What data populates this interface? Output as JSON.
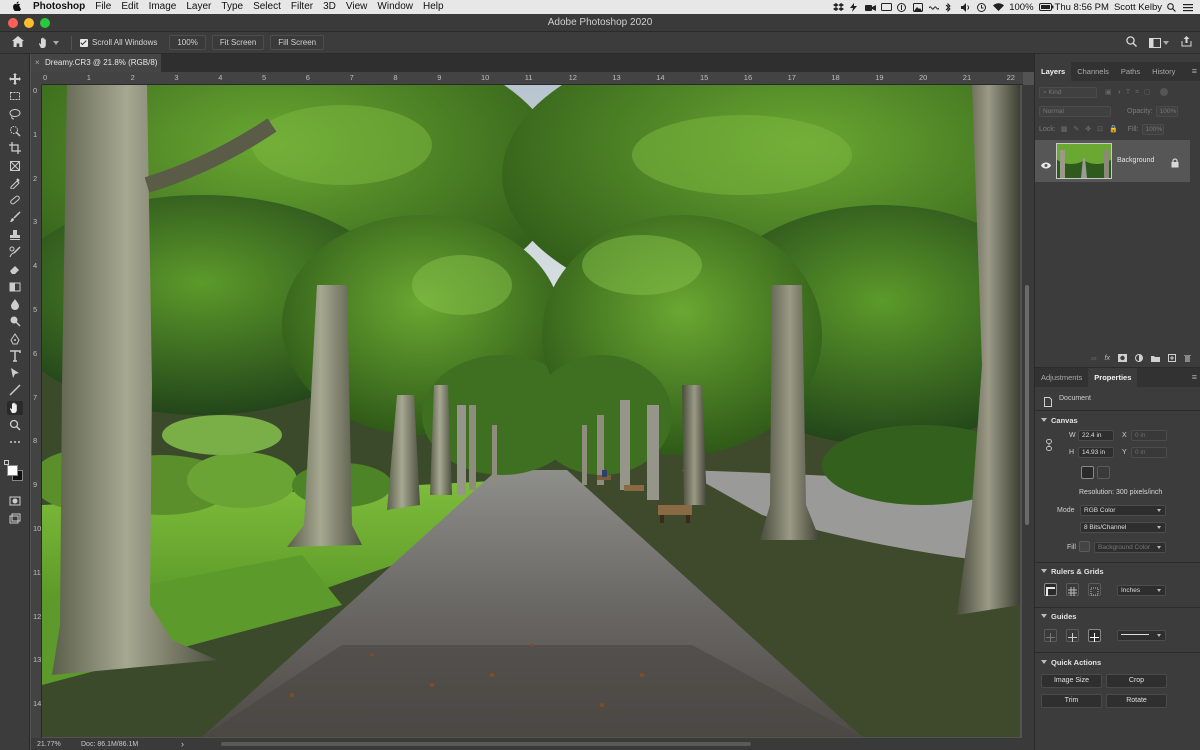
{
  "menubar": {
    "app_name": "Photoshop",
    "items": [
      "File",
      "Edit",
      "Image",
      "Layer",
      "Type",
      "Select",
      "Filter",
      "3D",
      "View",
      "Window",
      "Help"
    ],
    "battery": "100%",
    "clock": "Thu 8:56 PM",
    "user": "Scott Kelby"
  },
  "window": {
    "title": "Adobe Photoshop 2020",
    "traffic_colors": [
      "#ff5f56",
      "#ffbd2e",
      "#27c93f"
    ]
  },
  "options_bar": {
    "scroll_all_windows": "Scroll All Windows",
    "zoom_100": "100%",
    "fit_screen": "Fit Screen",
    "fill_screen": "Fill Screen"
  },
  "document": {
    "tab_title": "Dreamy.CR3 @ 21.8% (RGB/8)",
    "close_glyph": "×"
  },
  "rulers": {
    "top_labels": [
      "0",
      "1",
      "2",
      "3",
      "4",
      "5",
      "6",
      "7",
      "8",
      "9",
      "10",
      "11",
      "12",
      "13",
      "14",
      "15",
      "16",
      "17",
      "18",
      "19",
      "20",
      "21",
      "22"
    ],
    "left_labels": [
      "0",
      "1",
      "2",
      "3",
      "4",
      "5",
      "6",
      "7",
      "8",
      "9",
      "10",
      "11",
      "12",
      "13",
      "14"
    ]
  },
  "status": {
    "zoom": "21.77%",
    "doc_size": "Doc: 86.1M/86.1M",
    "arrow": "›"
  },
  "layers_panel": {
    "tabs": [
      "Layers",
      "Channels",
      "Paths",
      "History"
    ],
    "filter_placeholder": "Kind",
    "blend_mode": "Normal",
    "opacity_label": "Opacity:",
    "opacity_value": "100%",
    "lock_label": "Lock:",
    "fill_label": "Fill:",
    "fill_value": "100%",
    "layer_name": "Background"
  },
  "properties_panel": {
    "tabs": [
      "Adjustments",
      "Properties"
    ],
    "type_label": "Document",
    "canvas_title": "Canvas",
    "w_label": "W",
    "w_value": "22.4 in",
    "h_label": "H",
    "h_value": "14.93 in",
    "x_label": "X",
    "x_value": "0 in",
    "y_label": "Y",
    "y_value": "0 in",
    "resolution": "Resolution: 300 pixels/inch",
    "mode_label": "Mode",
    "mode_value": "RGB Color",
    "bits_value": "8 Bits/Channel",
    "fill_label": "Fill",
    "fill_value": "Background Color",
    "rulers_title": "Rulers & Grids",
    "units_value": "Inches",
    "guides_title": "Guides",
    "quick_actions_title": "Quick Actions",
    "buttons": [
      "Image Size",
      "Crop",
      "Trim",
      "Rotate"
    ]
  }
}
